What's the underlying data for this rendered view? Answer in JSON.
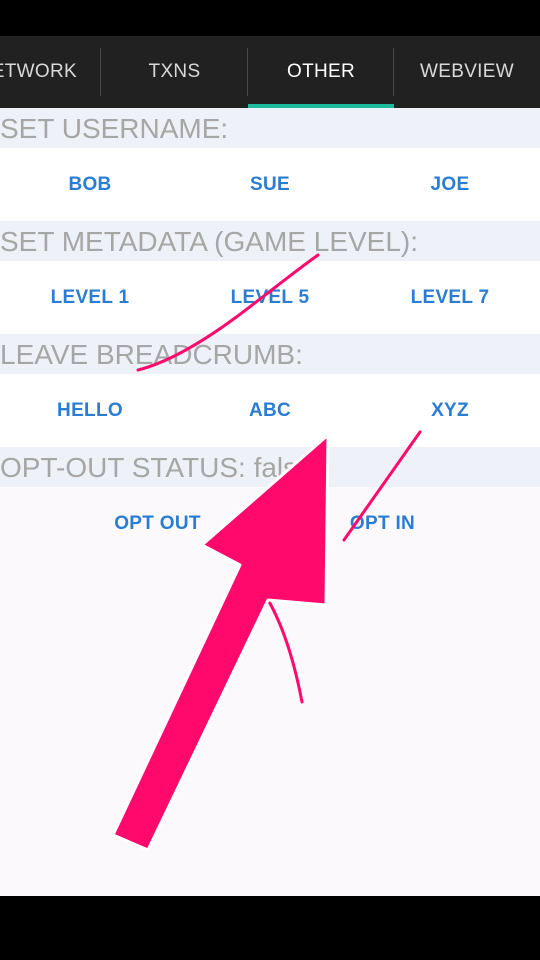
{
  "tabs": [
    {
      "label": "NETWORK"
    },
    {
      "label": "TXNS"
    },
    {
      "label": "OTHER",
      "active": true
    },
    {
      "label": "WEBVIEW"
    }
  ],
  "sections": {
    "username": {
      "header": "SET USERNAME:",
      "buttons": [
        "BOB",
        "SUE",
        "JOE"
      ]
    },
    "metadata": {
      "header": "SET METADATA (GAME LEVEL):",
      "buttons": [
        "LEVEL 1",
        "LEVEL 5",
        "LEVEL 7"
      ]
    },
    "breadcrumb": {
      "header": "LEAVE BREADCRUMB:",
      "buttons": [
        "HELLO",
        "ABC",
        "XYZ"
      ]
    },
    "optout": {
      "header": "OPT-OUT STATUS: false",
      "buttons": [
        "OPT OUT",
        "OPT IN"
      ]
    }
  },
  "colors": {
    "accent": "#1abc9c",
    "button_text": "#2b7cd3",
    "annotation": "#ff0a6c"
  }
}
